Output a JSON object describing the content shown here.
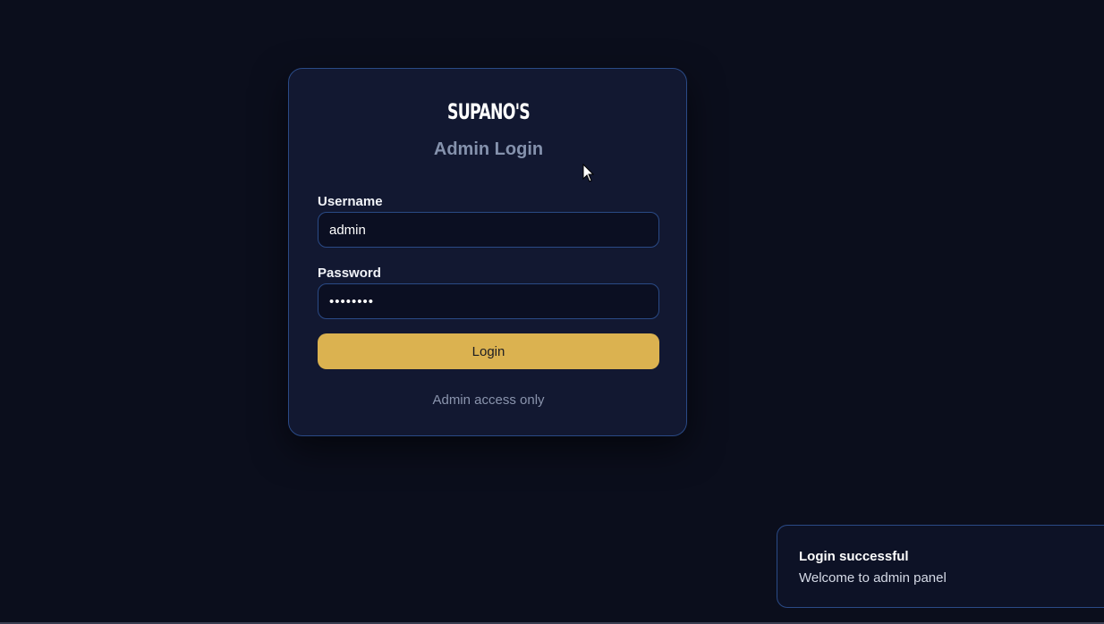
{
  "login_card": {
    "brand": "SUPANO'S",
    "title": "Admin Login",
    "username_label": "Username",
    "username_value": "admin",
    "password_label": "Password",
    "password_value": "admin123",
    "login_button_label": "Login",
    "footer_note": "Admin access only"
  },
  "toast": {
    "title": "Login successful",
    "message": "Welcome to admin panel"
  },
  "colors": {
    "background": "#0b0e1c",
    "card": "#121831",
    "border": "#2a4a86",
    "accent": "#dbb250",
    "muted_text": "#8592ad"
  },
  "icons": {
    "cursor": "mouse-pointer-icon"
  }
}
